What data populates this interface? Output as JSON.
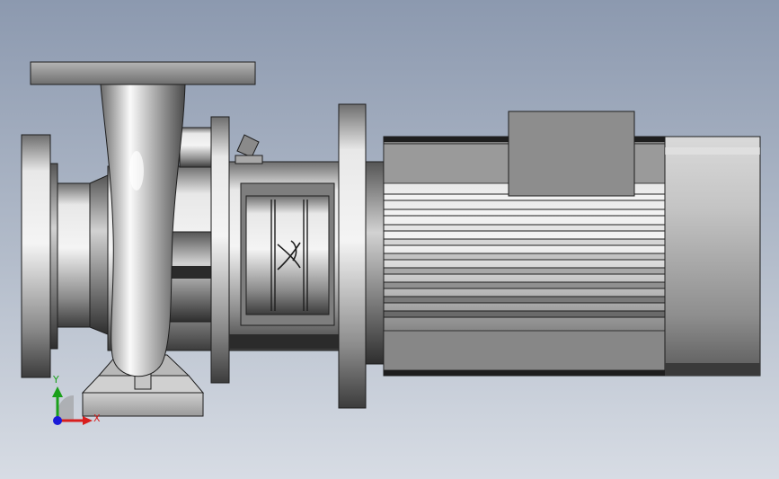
{
  "triad": {
    "y_label": "Y",
    "x_label": "X",
    "y_color": "#1aa01a",
    "x_color": "#d81e1e",
    "origin_color": "#1a1ad8"
  },
  "colors": {
    "background_top": "#8d9ab0",
    "background_bottom": "#d6dbe3",
    "metal_light": "#ececec",
    "metal_mid": "#9a9a9a",
    "metal_dark": "#3a3a3a",
    "outline": "#1e1e1e"
  },
  "icons": {
    "logo": "manufacturer-logo-icon"
  }
}
